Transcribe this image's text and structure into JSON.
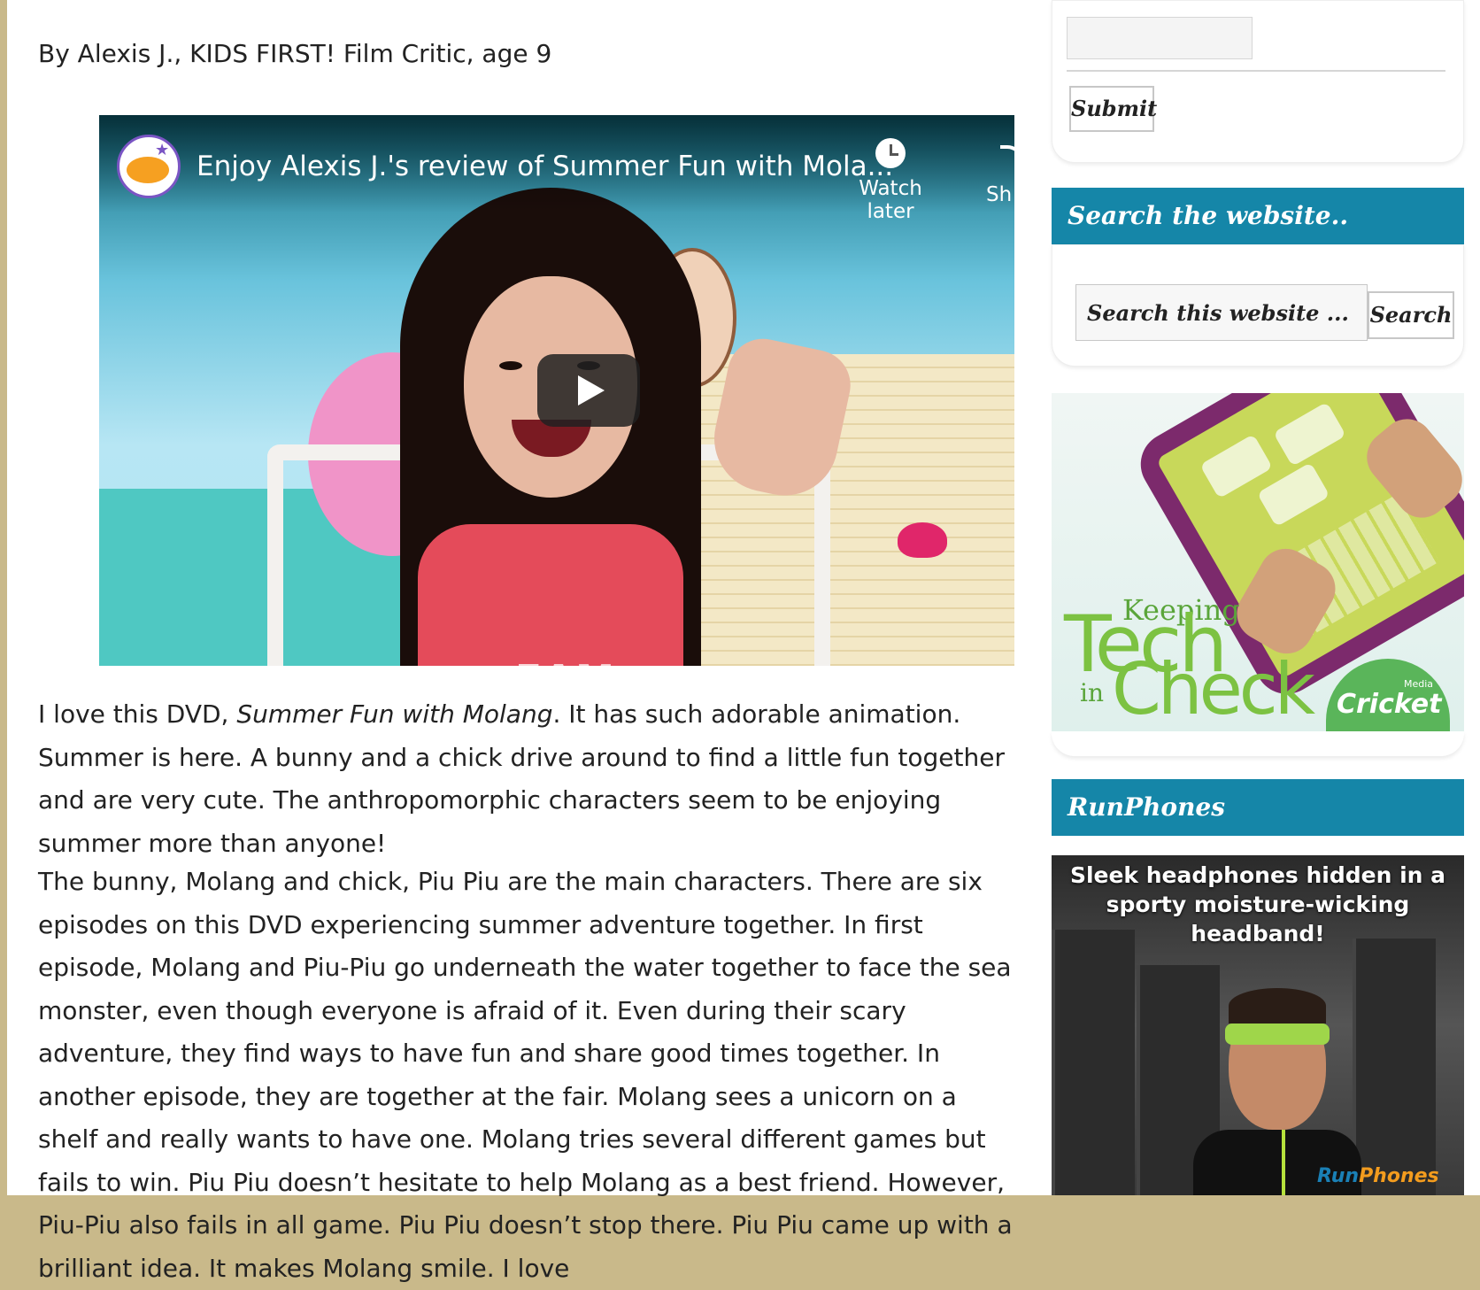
{
  "article": {
    "byline": "By Alexis J., KIDS FIRST! Film Critic, age 9",
    "p1_pre": "I love this DVD, ",
    "p1_title": "Summer Fun with Molang",
    "p1_post": ". It has such adorable animation. Summer is here. A bunny and a chick drive around to find a little fun together and are very cute. The anthropomorphic characters seem to be enjoying summer more than anyone!",
    "p2": "The bunny, Molang and chick, Piu Piu are the main characters. There are six episodes on this DVD experiencing summer adventure together. In first episode, Molang and Piu-Piu go underneath the water together to face the sea monster, even though everyone is afraid of it. Even during their scary adventure, they find ways to have fun and share good times together. In another episode, they are together at the fair. Molang sees a unicorn on a shelf and really wants to have one. Molang tries several different games but fails to win. Piu Piu doesn’t hesitate to help Molang as a best friend. However, Piu-Piu also fails in all game. Piu Piu doesn’t stop there. Piu Piu came up with a brilliant idea. It makes Molang smile. I love"
  },
  "video": {
    "title": "Enjoy Alexis J.'s review of Summer Fun with Mola...",
    "watch_later": "Watch later",
    "share": "Sh",
    "shirt_text": "EAM",
    "channel_logo": "kids-first-film-critic-logo"
  },
  "sidebar": {
    "submit_label": "Submit",
    "search_title": "Search the website..",
    "search_placeholder": "Search this website ...",
    "search_button": "Search",
    "runphones_title": "RunPhones"
  },
  "ad_tech": {
    "keeping": "Keeping",
    "tech": "Tech",
    "in": "in",
    "check": "Check",
    "brand": "Cricket",
    "brand_small": "Media"
  },
  "ad_runphones": {
    "headline": "Sleek headphones hidden in a sporty moisture-wicking headband!",
    "logo_run": "Run",
    "logo_phones": "Phones"
  },
  "colors": {
    "widget_title_bg": "#1586a8",
    "page_border": "#c9b98a"
  }
}
